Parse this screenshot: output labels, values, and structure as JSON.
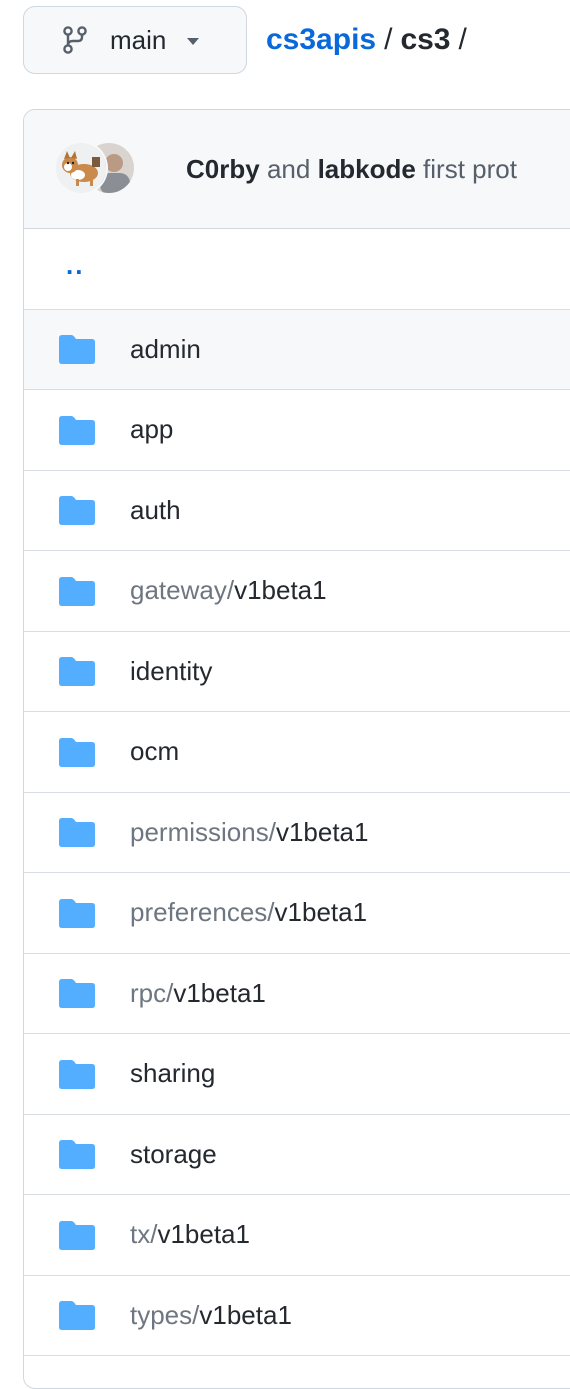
{
  "branch": {
    "name": "main"
  },
  "breadcrumb": {
    "repo": "cs3apis",
    "separator": "/",
    "current": "cs3",
    "trailing": "/"
  },
  "commit": {
    "author1": "C0rby",
    "conjunction": "and",
    "author2": "labkode",
    "message": "first prot"
  },
  "parent_dir": {
    "label": ".."
  },
  "colors": {
    "accent": "#0969da",
    "folder": "#54aeff",
    "header_bg": "#f6f8fa",
    "border": "#d0d7de"
  },
  "icons": {
    "branch": "git-branch-icon",
    "caret": "triangle-down-icon",
    "folder": "file-directory-fill-icon"
  },
  "files": [
    {
      "prefix": "",
      "name": "admin",
      "type": "dir"
    },
    {
      "prefix": "",
      "name": "app",
      "type": "dir"
    },
    {
      "prefix": "",
      "name": "auth",
      "type": "dir"
    },
    {
      "prefix": "gateway/",
      "name": "v1beta1",
      "type": "dir"
    },
    {
      "prefix": "",
      "name": "identity",
      "type": "dir"
    },
    {
      "prefix": "",
      "name": "ocm",
      "type": "dir"
    },
    {
      "prefix": "permissions/",
      "name": "v1beta1",
      "type": "dir"
    },
    {
      "prefix": "preferences/",
      "name": "v1beta1",
      "type": "dir"
    },
    {
      "prefix": "rpc/",
      "name": "v1beta1",
      "type": "dir"
    },
    {
      "prefix": "",
      "name": "sharing",
      "type": "dir"
    },
    {
      "prefix": "",
      "name": "storage",
      "type": "dir"
    },
    {
      "prefix": "tx/",
      "name": "v1beta1",
      "type": "dir"
    },
    {
      "prefix": "types/",
      "name": "v1beta1",
      "type": "dir"
    }
  ]
}
